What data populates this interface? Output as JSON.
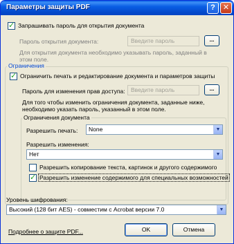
{
  "window": {
    "title": "Параметры защиты PDF",
    "help_glyph": "?",
    "close_glyph": "✕"
  },
  "open_password": {
    "require_label": "Запрашивать пароль для открытия документа",
    "require_checked": true,
    "field_label": "Пароль открытия документа:",
    "field_placeholder": "Введите пароль",
    "browse_label": "...",
    "hint": [
      "Для открытия документа необходимо указывать пароль, заданный в",
      "этом поле."
    ]
  },
  "restrictions": {
    "group_title": "Ограничения",
    "restrict_label": "Ограничить печать и редактирование документа и параметров защиты",
    "restrict_checked": true,
    "perm_field_label": "Пароль для изменения прав доступа:",
    "perm_field_placeholder": "Введите пароль",
    "browse_label": "...",
    "hint": [
      "Для того чтобы изменить ограничения документа, заданные ниже,",
      "необходимо указать пароль, указанный в этом поле."
    ],
    "doc_restrictions_title": "Ограничения документа",
    "print_label": "Разрешить печать:",
    "print_value": "None",
    "changes_label": "Разрешить изменения:",
    "changes_value": "Нет",
    "copy_label": "Разрешить копирование текста, картинок и другого содержимого",
    "copy_checked": false,
    "accessibility_label": "Разрешить изменение содержимого для специальных возможностей",
    "accessibility_checked": true
  },
  "encryption": {
    "label": "Уровень шифрования:",
    "value": "Высокий (128 бит AES) - совместим с Acrobat версии 7.0"
  },
  "footer": {
    "more_link": "Подробнее о защите PDF...",
    "ok_label": "OK",
    "cancel_label": "Отмена"
  }
}
